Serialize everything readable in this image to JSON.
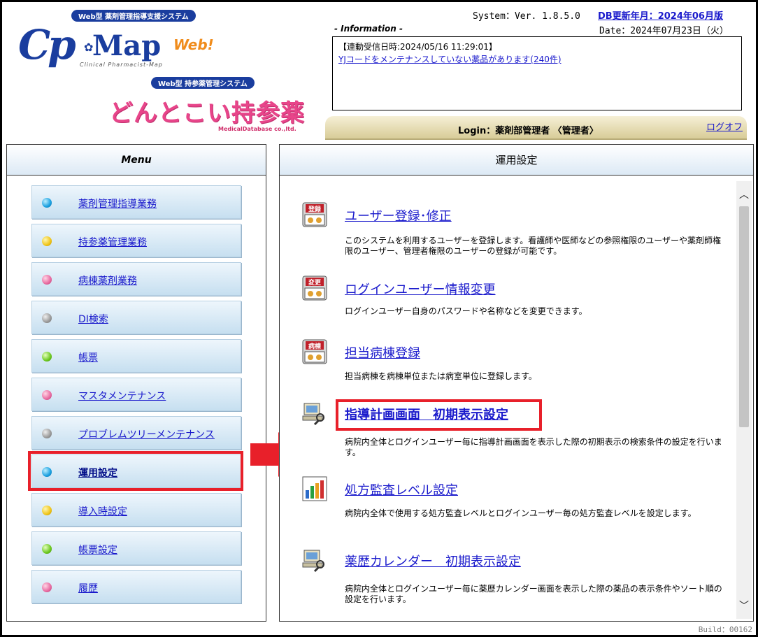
{
  "logo": {
    "tag_top": "Web型 薬剤管理指導支援システム",
    "brand_cp": "Cp",
    "brand_map": "Map",
    "brand_web": "Web!",
    "brand_sub": "Clinical Pharmacist-Map",
    "tag_mid": "Web型 持参薬管理システム",
    "brand_jp": "どんとこい持参薬",
    "company": "MedicalDatabase co.,ltd."
  },
  "header": {
    "system": "System：Ver. 1.8.5.0",
    "db_update": "DB更新年月：2024年06月版",
    "info_label": "- Information -",
    "date": "Date：2024年07月23日（火）",
    "info_line1": "【連動受信日時:2024/05/16 11:29:01】",
    "info_link": "YJコードをメンテナンスしていない薬品があります(240件)",
    "login": "Login：薬剤部管理者 〈管理者〉",
    "logoff": "ログオフ"
  },
  "menu": {
    "title": "Menu",
    "items": [
      {
        "label": "薬剤管理指導業務",
        "color": "#1aa0e0"
      },
      {
        "label": "持参薬管理業務",
        "color": "#f0c418"
      },
      {
        "label": "病棟薬剤業務",
        "color": "#e86aa0"
      },
      {
        "label": "DI検索",
        "color": "#9a9a9a"
      },
      {
        "label": "帳票",
        "color": "#6cc820"
      },
      {
        "label": "マスタメンテナンス",
        "color": "#e86aa0"
      },
      {
        "label": "プロブレムツリーメンテナンス",
        "color": "#9a9a9a"
      },
      {
        "label": "運用設定",
        "color": "#1aa0e0"
      },
      {
        "label": "導入時設定",
        "color": "#f0c418"
      },
      {
        "label": "帳票設定",
        "color": "#6cc820"
      },
      {
        "label": "履歴",
        "color": "#e86aa0"
      }
    ]
  },
  "main": {
    "title": "運用設定",
    "entries": [
      {
        "icon": "touroku-icon",
        "icon_text": "登録",
        "title": "ユーザー登録･修正",
        "desc": "このシステムを利用するユーザーを登録します。看護師や医師などの参照権限のユーザーや薬剤師権限のユーザー、管理者権限のユーザーの登録が可能です。"
      },
      {
        "icon": "henkou-icon",
        "icon_text": "変更",
        "title": "ログインユーザー情報変更",
        "desc": "ログインユーザー自身のパスワードや名称などを変更できます。"
      },
      {
        "icon": "byoutou-icon",
        "icon_text": "病棟",
        "title": "担当病棟登録",
        "desc": "担当病棟を病棟単位または病室単位に登録します。"
      },
      {
        "icon": "computer-tool-icon",
        "icon_text": "",
        "title": "指導計画画面　初期表示設定",
        "desc": "病院内全体とログインユーザー毎に指導計画画面を表示した際の初期表示の検索条件の設定を行います。"
      },
      {
        "icon": "bar-chart-icon",
        "icon_text": "",
        "title": "処方監査レベル設定",
        "desc": "病院内全体で使用する処方監査レベルとログインユーザー毎の処方監査レベルを設定します。"
      },
      {
        "icon": "computer-tool-icon",
        "icon_text": "",
        "title": "薬歴カレンダー　初期表示設定",
        "desc": "病院内全体とログインユーザー毎に薬歴カレンダー画面を表示した際の薬品の表示条件やソート順の設定を行います。"
      }
    ]
  },
  "footer": {
    "build": "Build：00162"
  },
  "colors": {
    "link": "#1a1acc",
    "highlight": "#e8202a",
    "brand_blue": "#1a3d9e",
    "brand_pink": "#e8458a"
  }
}
